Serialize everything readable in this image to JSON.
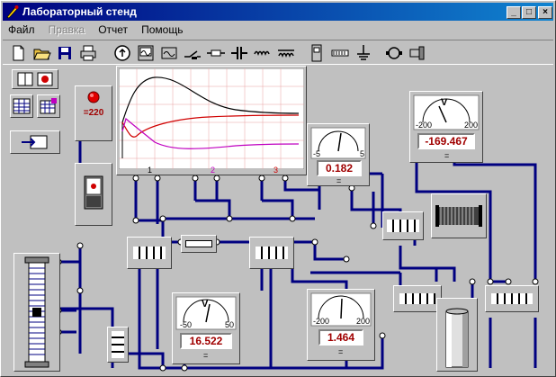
{
  "window": {
    "title": "Лабораторный стенд",
    "minimize": "_",
    "maximize": "□",
    "close": "×"
  },
  "menu": [
    {
      "label": "Файл",
      "enabled": true
    },
    {
      "label": "Правка",
      "enabled": false
    },
    {
      "label": "Отчет",
      "enabled": true
    },
    {
      "label": "Помощь",
      "enabled": true
    }
  ],
  "toolbar": {
    "icons": [
      "new-file-icon",
      "open-folder-icon",
      "save-icon",
      "print-icon",
      "ammeter-source-icon",
      "oscilloscope-icon",
      "generator-icon",
      "switch-icon",
      "resistor-icon",
      "capacitor-icon",
      "inductor-icon",
      "transformer-icon",
      "toggle-icon",
      "rheostat-icon",
      "ground-icon",
      "motor-icon",
      "connector-icon"
    ]
  },
  "source": {
    "label": "=220"
  },
  "oscilloscope": {
    "channels": [
      "1",
      "2",
      "3"
    ]
  },
  "meters": {
    "voltmeter_top": {
      "unit": "V",
      "scale_min": "-200",
      "scale_max": "200",
      "reading": "-169.467",
      "dc": "="
    },
    "ammeter_mid": {
      "scale_min": "-5",
      "scale_max": "5",
      "reading": "0.182",
      "dc": "="
    },
    "voltmeter_bottom": {
      "unit": "V",
      "scale_min": "-50",
      "scale_max": "50",
      "reading": "16.522",
      "dc": "="
    },
    "ammeter_bottom": {
      "scale_min": "-200",
      "scale_max": "200",
      "reading": "1.464",
      "dc": "="
    }
  },
  "colors": {
    "wire": "#000080",
    "curve_black": "#000000",
    "curve_red": "#d00000",
    "curve_magenta": "#c000c0",
    "lcd_text": "#a00000"
  }
}
